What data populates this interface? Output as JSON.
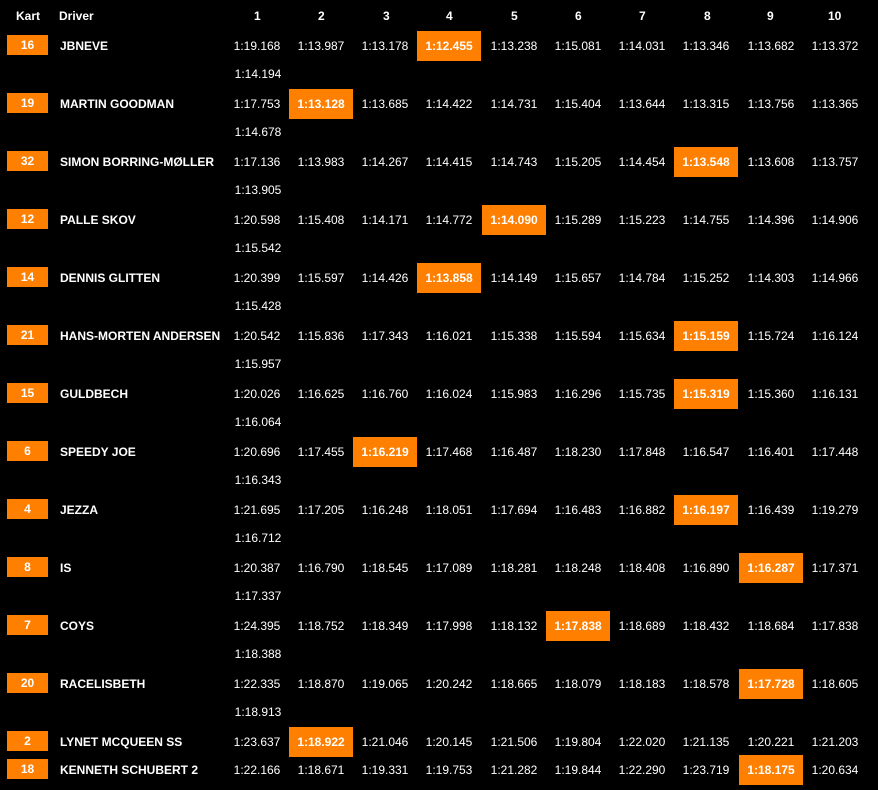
{
  "header": {
    "kart": "Kart",
    "driver": "Driver",
    "laps": [
      "1",
      "2",
      "3",
      "4",
      "5",
      "6",
      "7",
      "8",
      "9",
      "10"
    ]
  },
  "rows": [
    {
      "kart": "16",
      "driver": "JBNEVE",
      "laps": [
        "1:19.168",
        "1:13.987",
        "1:13.178",
        "1:12.455",
        "1:13.238",
        "1:15.081",
        "1:14.031",
        "1:13.346",
        "1:13.682",
        "1:13.372"
      ],
      "best": 3,
      "extra": "1:14.194"
    },
    {
      "kart": "19",
      "driver": "MARTIN GOODMAN",
      "laps": [
        "1:17.753",
        "1:13.128",
        "1:13.685",
        "1:14.422",
        "1:14.731",
        "1:15.404",
        "1:13.644",
        "1:13.315",
        "1:13.756",
        "1:13.365"
      ],
      "best": 1,
      "extra": "1:14.678"
    },
    {
      "kart": "32",
      "driver": "SIMON BORRING-MØLLER",
      "laps": [
        "1:17.136",
        "1:13.983",
        "1:14.267",
        "1:14.415",
        "1:14.743",
        "1:15.205",
        "1:14.454",
        "1:13.548",
        "1:13.608",
        "1:13.757"
      ],
      "best": 7,
      "extra": "1:13.905"
    },
    {
      "kart": "12",
      "driver": "PALLE SKOV",
      "laps": [
        "1:20.598",
        "1:15.408",
        "1:14.171",
        "1:14.772",
        "1:14.090",
        "1:15.289",
        "1:15.223",
        "1:14.755",
        "1:14.396",
        "1:14.906"
      ],
      "best": 4,
      "extra": "1:15.542"
    },
    {
      "kart": "14",
      "driver": "DENNIS GLITTEN",
      "laps": [
        "1:20.399",
        "1:15.597",
        "1:14.426",
        "1:13.858",
        "1:14.149",
        "1:15.657",
        "1:14.784",
        "1:15.252",
        "1:14.303",
        "1:14.966"
      ],
      "best": 3,
      "extra": "1:15.428"
    },
    {
      "kart": "21",
      "driver": "HANS-MORTEN ANDERSEN",
      "laps": [
        "1:20.542",
        "1:15.836",
        "1:17.343",
        "1:16.021",
        "1:15.338",
        "1:15.594",
        "1:15.634",
        "1:15.159",
        "1:15.724",
        "1:16.124"
      ],
      "best": 7,
      "extra": "1:15.957"
    },
    {
      "kart": "15",
      "driver": "GULDBECH",
      "laps": [
        "1:20.026",
        "1:16.625",
        "1:16.760",
        "1:16.024",
        "1:15.983",
        "1:16.296",
        "1:15.735",
        "1:15.319",
        "1:15.360",
        "1:16.131"
      ],
      "best": 7,
      "extra": "1:16.064"
    },
    {
      "kart": "6",
      "driver": "SPEEDY JOE",
      "laps": [
        "1:20.696",
        "1:17.455",
        "1:16.219",
        "1:17.468",
        "1:16.487",
        "1:18.230",
        "1:17.848",
        "1:16.547",
        "1:16.401",
        "1:17.448"
      ],
      "best": 2,
      "extra": "1:16.343"
    },
    {
      "kart": "4",
      "driver": "JEZZA",
      "laps": [
        "1:21.695",
        "1:17.205",
        "1:16.248",
        "1:18.051",
        "1:17.694",
        "1:16.483",
        "1:16.882",
        "1:16.197",
        "1:16.439",
        "1:19.279"
      ],
      "best": 7,
      "extra": "1:16.712"
    },
    {
      "kart": "8",
      "driver": "IS",
      "laps": [
        "1:20.387",
        "1:16.790",
        "1:18.545",
        "1:17.089",
        "1:18.281",
        "1:18.248",
        "1:18.408",
        "1:16.890",
        "1:16.287",
        "1:17.371"
      ],
      "best": 8,
      "extra": "1:17.337"
    },
    {
      "kart": "7",
      "driver": "COYS",
      "laps": [
        "1:24.395",
        "1:18.752",
        "1:18.349",
        "1:17.998",
        "1:18.132",
        "1:17.838",
        "1:18.689",
        "1:18.432",
        "1:18.684",
        "1:17.838"
      ],
      "best": 5,
      "extra": "1:18.388"
    },
    {
      "kart": "20",
      "driver": "RACELISBETH",
      "laps": [
        "1:22.335",
        "1:18.870",
        "1:19.065",
        "1:20.242",
        "1:18.665",
        "1:18.079",
        "1:18.183",
        "1:18.578",
        "1:17.728",
        "1:18.605"
      ],
      "best": 8,
      "extra": "1:18.913"
    },
    {
      "kart": "2",
      "driver": "LYNET MCQUEEN SS",
      "laps": [
        "1:23.637",
        "1:18.922",
        "1:21.046",
        "1:20.145",
        "1:21.506",
        "1:19.804",
        "1:22.020",
        "1:21.135",
        "1:20.221",
        "1:21.203"
      ],
      "best": 1,
      "extra": ""
    },
    {
      "kart": "18",
      "driver": "KENNETH SCHUBERT 2",
      "laps": [
        "1:22.166",
        "1:18.671",
        "1:19.331",
        "1:19.753",
        "1:21.282",
        "1:19.844",
        "1:22.290",
        "1:23.719",
        "1:18.175",
        "1:20.634"
      ],
      "best": 8,
      "extra": ""
    }
  ],
  "colors": {
    "accent": "#ff7f00",
    "background": "#000000",
    "text": "#ffffff"
  }
}
